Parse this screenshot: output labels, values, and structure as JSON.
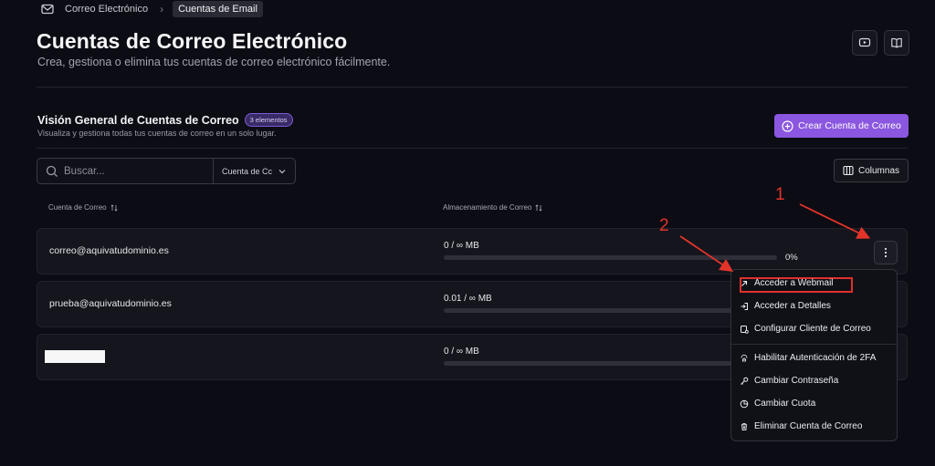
{
  "breadcrumb": {
    "parent": "Correo Electrónico",
    "current": "Cuentas de Email"
  },
  "page": {
    "title": "Cuentas de Correo Electrónico",
    "subtitle": "Crea, gestiona o elimina tus cuentas de correo electrónico fácilmente."
  },
  "section": {
    "title": "Visión General de Cuentas de Correo",
    "badge": "3 elementos",
    "subtitle": "Visualiza y gestiona todas tus cuentas de correo en un solo lugar.",
    "create_label": "Crear Cuenta de Correo"
  },
  "search": {
    "placeholder": "Buscar...",
    "filter_value": "Cuenta de Cc"
  },
  "columns_label": "Columnas",
  "table": {
    "headers": [
      "Cuenta de Correo",
      "Almacenamiento de Correo"
    ],
    "rows": [
      {
        "email": "correo@aquivatudominio.es",
        "storage": "0 / ∞ MB",
        "percent": "0%",
        "usage": 0
      },
      {
        "email": "prueba@aquivatudominio.es",
        "storage": "0.01 / ∞ MB",
        "usage": 0
      },
      {
        "email": "",
        "storage": "0 / ∞ MB",
        "usage": 0
      }
    ]
  },
  "menu": {
    "items": [
      "Acceder a Webmail",
      "Acceder a Detalles",
      "Configurar Cliente de Correo",
      "Habilitar Autenticación de 2FA",
      "Cambiar Contraseña",
      "Cambiar Cuota",
      "Eliminar Cuenta de Correo"
    ]
  },
  "annotations": [
    "1",
    "2"
  ],
  "colors": {
    "accent": "#8b57e0",
    "annotation": "#e0302a",
    "background": "#0c0c14"
  }
}
